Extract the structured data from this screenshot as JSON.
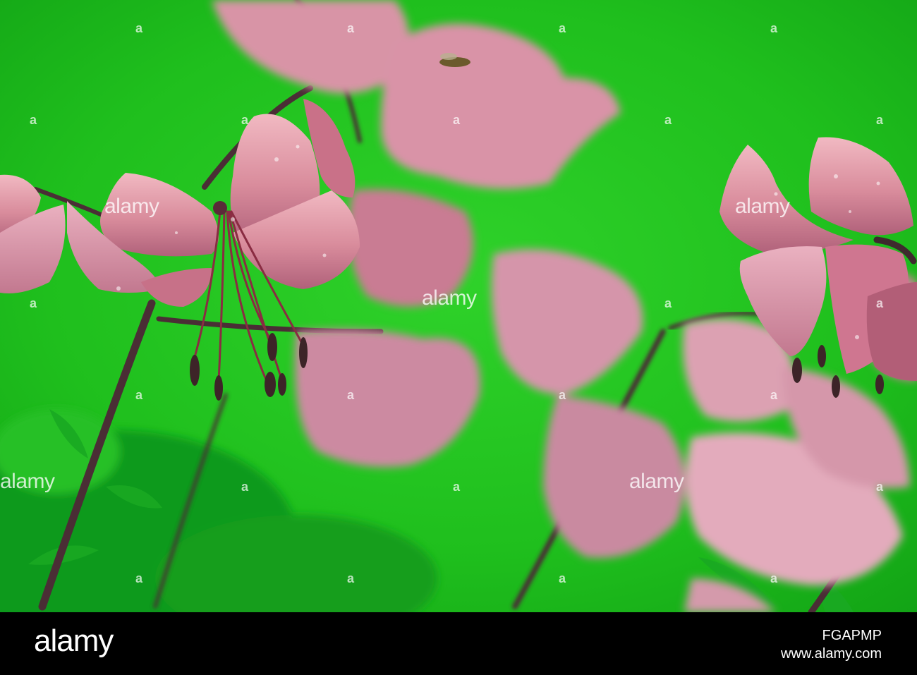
{
  "photo": {
    "subject_colors": {
      "background": "#1fc21f",
      "petal": "#d98c9c",
      "petal_shadow": "#a8566e",
      "stem": "#4a2e35"
    }
  },
  "watermarks": {
    "alamy_text": "alamy",
    "alamy_mark": "a"
  },
  "footer_bar": {
    "logo": "alamy",
    "image_id": "FGAPMP",
    "domain": "www.alamy.com"
  }
}
